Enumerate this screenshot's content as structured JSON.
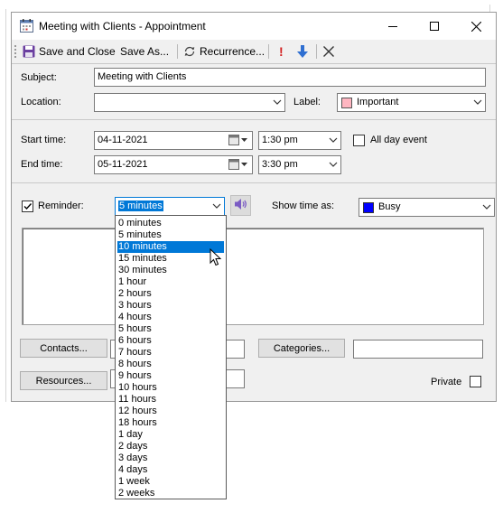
{
  "window": {
    "title": "Meeting with Clients - Appointment"
  },
  "toolbar": {
    "save_close": "Save and Close",
    "save_as": "Save As...",
    "recurrence": "Recurrence...",
    "importance_glyph": "!"
  },
  "form": {
    "subject_label": "Subject:",
    "subject_value": "Meeting with Clients",
    "location_label": "Location:",
    "location_value": "",
    "label_label": "Label:",
    "label_value": "Important",
    "label_color": "#ffb6c1",
    "start_label": "Start time:",
    "start_date": "04-11-2021",
    "start_time": "1:30 pm",
    "end_label": "End time:",
    "end_date": "05-11-2021",
    "end_time": "3:30 pm",
    "all_day_label": "All day event",
    "reminder_label": "Reminder:",
    "reminder_value": "5 minutes",
    "show_time_label": "Show time as:",
    "show_time_value": "Busy",
    "show_time_color": "#0000ff",
    "contacts_button": "Contacts...",
    "categories_button": "Categories...",
    "resources_button": "Resources...",
    "private_label": "Private"
  },
  "reminder_options": [
    "0 minutes",
    "5 minutes",
    "10 minutes",
    "15 minutes",
    "30 minutes",
    "1 hour",
    "2 hours",
    "3 hours",
    "4 hours",
    "5 hours",
    "6 hours",
    "7 hours",
    "8 hours",
    "9 hours",
    "10 hours",
    "11 hours",
    "12 hours",
    "18 hours",
    "1 day",
    "2 days",
    "3 days",
    "4 days",
    "1 week",
    "2 weeks"
  ],
  "reminder_highlighted_index": 2,
  "colors": {
    "selection": "#0078d7",
    "speaker": "#7b5cc4"
  }
}
